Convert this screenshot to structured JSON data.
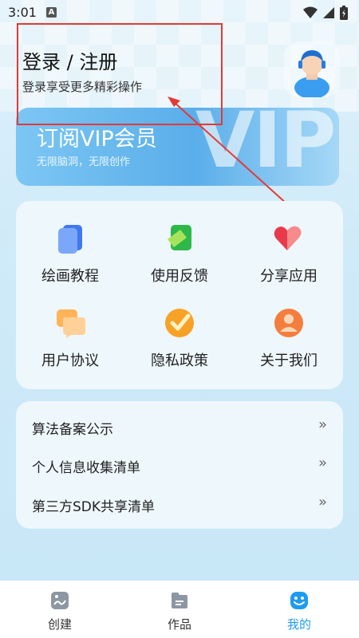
{
  "status_bar": {
    "time": "3:01",
    "notification_letter": "A"
  },
  "login": {
    "title": "登录 / 注册",
    "subtitle": "登录享受更多精彩操作"
  },
  "vip": {
    "title": "订阅VIP会员",
    "subtitle": "无限脑洞，无限创作",
    "watermark": "VIP"
  },
  "grid": {
    "items": [
      {
        "label": "绘画教程",
        "icon": "book-icon"
      },
      {
        "label": "使用反馈",
        "icon": "feedback-icon"
      },
      {
        "label": "分享应用",
        "icon": "heart-icon"
      },
      {
        "label": "用户协议",
        "icon": "chat-icon"
      },
      {
        "label": "隐私政策",
        "icon": "shield-check-icon"
      },
      {
        "label": "关于我们",
        "icon": "person-icon"
      }
    ]
  },
  "list": {
    "items": [
      {
        "label": "算法备案公示",
        "chevron": "»"
      },
      {
        "label": "个人信息收集清单",
        "chevron": "»"
      },
      {
        "label": "第三方SDK共享清单",
        "chevron": "»"
      }
    ]
  },
  "bottom_nav": {
    "items": [
      {
        "label": "创建",
        "icon": "image-icon",
        "active": false
      },
      {
        "label": "作品",
        "icon": "folder-icon",
        "active": false
      },
      {
        "label": "我的",
        "icon": "smiley-icon",
        "active": true
      }
    ]
  },
  "colors": {
    "accent": "#1e9cf0",
    "annotation": "#e53935"
  }
}
